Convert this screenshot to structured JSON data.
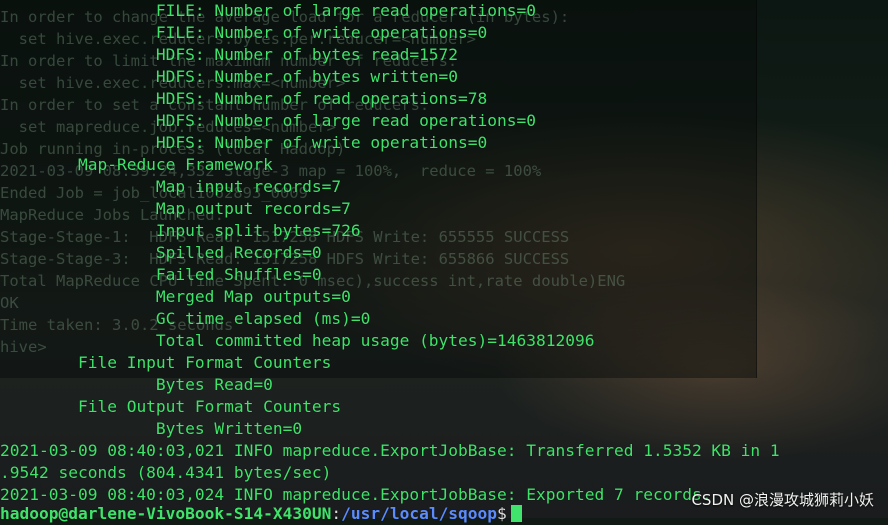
{
  "background_terminal": {
    "lines": [
      "In order to change the average load for a reducer (in bytes):",
      "  set hive.exec.reducers.bytes.per.reducer=<number>",
      "In order to limit the maximum number of reducers:",
      "  set hive.exec.reducers.max=<number>",
      "In order to set a constant number of reducers:",
      "  set mapreduce.job.reduces=<number>",
      "Job running in-process (local Hadoop)",
      "2021-03-09 08:39:24,332 Stage-3 map = 100%,  reduce = 100%",
      "Ended Job = job_local1062893_0009",
      "MapReduce Jobs Launched:",
      "Stage-Stage-1:  HDFS Read: 1517258 HDFS Write: 655555 SUCCESS",
      "Stage-Stage-3:  HDFS Read: 1517258 HDFS Write: 655866 SUCCESS",
      "Total MapReduce CPU Time Spent: 0 msec),success int,rate double)ENG",
      "OK",
      "Time taken: 3.0.2 seconds",
      "hive> "
    ]
  },
  "terminal": {
    "lines": [
      "                FILE: Number of large read operations=0",
      "                FILE: Number of write operations=0",
      "                HDFS: Number of bytes read=1572",
      "                HDFS: Number of bytes written=0",
      "                HDFS: Number of read operations=78",
      "                HDFS: Number of large read operations=0",
      "                HDFS: Number of write operations=0",
      "        Map-Reduce Framework",
      "                Map input records=7",
      "                Map output records=7",
      "                Input split bytes=726",
      "                Spilled Records=0",
      "                Failed Shuffles=0",
      "                Merged Map outputs=0",
      "                GC time elapsed (ms)=0",
      "                Total committed heap usage (bytes)=1463812096",
      "        File Input Format Counters",
      "                Bytes Read=0",
      "        File Output Format Counters",
      "                Bytes Written=0",
      "2021-03-09 08:40:03,021 INFO mapreduce.ExportJobBase: Transferred 1.5352 KB in 1",
      ".9542 seconds (804.4341 bytes/sec)",
      "2021-03-09 08:40:03,024 INFO mapreduce.ExportJobBase: Exported 7 records."
    ],
    "prompt": {
      "user_host": "hadoop@darlene-VivoBook-S14-X430UN",
      "separator": ":",
      "path": "/usr/local/sqoop",
      "symbol": "$"
    }
  },
  "watermark": "CSDN @浪漫攻城狮莉小妖",
  "colors": {
    "terminal_text": "#3fe36a",
    "prompt_path": "#5a8cff",
    "background": "#121a16"
  }
}
